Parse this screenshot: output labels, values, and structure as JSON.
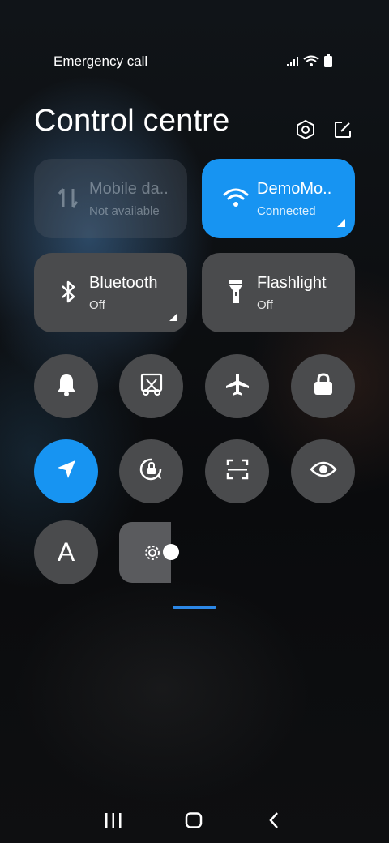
{
  "status_bar": {
    "carrier": "Emergency call",
    "icons": [
      "signal-icon",
      "wifi-icon",
      "battery-icon"
    ]
  },
  "header": {
    "title": "Control centre",
    "icons": [
      "settings-icon",
      "edit-icon"
    ]
  },
  "tiles": [
    {
      "name": "Mobile da..",
      "sub": "Not available",
      "state": "disabled",
      "icon": "mobile-data-icon"
    },
    {
      "name": "DemoMo..",
      "sub": "Connected",
      "state": "on",
      "icon": "wifi-icon"
    },
    {
      "name": "Bluetooth",
      "sub": "Off",
      "state": "off",
      "icon": "bluetooth-icon"
    },
    {
      "name": "Flashlight",
      "sub": "Off",
      "state": "off",
      "icon": "flashlight-icon"
    }
  ],
  "toggles": [
    {
      "icon": "bell-icon",
      "state": "off"
    },
    {
      "icon": "screenshot-icon",
      "state": "off"
    },
    {
      "icon": "airplane-icon",
      "state": "off"
    },
    {
      "icon": "lock-icon",
      "state": "off"
    },
    {
      "icon": "location-icon",
      "state": "on"
    },
    {
      "icon": "rotation-lock-icon",
      "state": "off"
    },
    {
      "icon": "scanner-icon",
      "state": "off"
    },
    {
      "icon": "eye-icon",
      "state": "off"
    },
    {
      "icon": "font-icon",
      "label": "A",
      "state": "off"
    }
  ],
  "brightness": {
    "icon": "brightness-icon",
    "level": 0.15
  },
  "colors": {
    "accent": "#1794f2",
    "tile": "#4a4b4d",
    "handle": "#2c87e6"
  },
  "navbar": {
    "icons": [
      "recents-icon",
      "home-icon",
      "back-icon"
    ]
  }
}
